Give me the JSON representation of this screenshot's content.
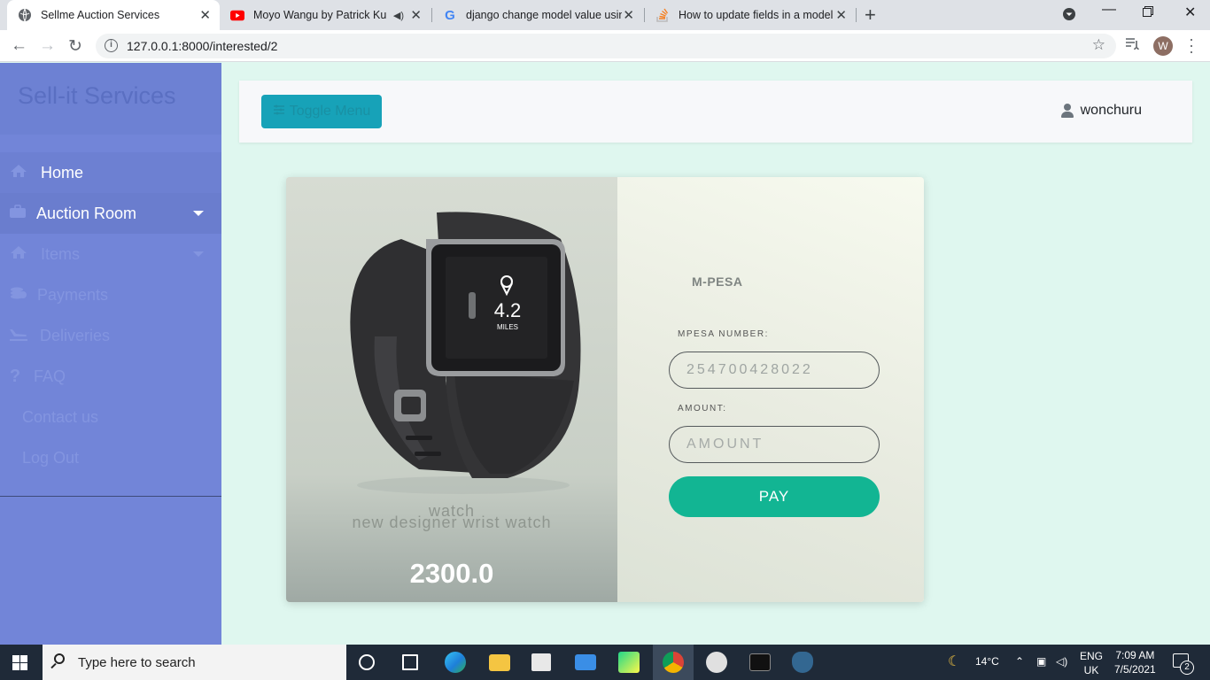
{
  "browser": {
    "tabs": [
      {
        "title": "Sellme Auction Services",
        "icon": "globe-icon",
        "active": true
      },
      {
        "title": "Moyo Wangu by Patrick Kub",
        "icon": "youtube-icon",
        "active": false
      },
      {
        "title": "django change model value usinc",
        "icon": "google-icon",
        "active": false
      },
      {
        "title": "How to update fields in a model",
        "icon": "stackoverflow-icon",
        "active": false
      }
    ],
    "url": "127.0.0.1:8000/interested/2",
    "profile_initial": "W"
  },
  "sidebar": {
    "brand": "Sell-it Services",
    "items": [
      {
        "label": "Home",
        "icon": "home-icon"
      },
      {
        "label": "Auction Room",
        "icon": "briefcase-icon"
      },
      {
        "label": "Items",
        "icon": "home-icon"
      },
      {
        "label": "Payments",
        "icon": "coins-icon"
      },
      {
        "label": "Deliveries",
        "icon": "plane-icon"
      },
      {
        "label": "FAQ",
        "icon": "question-icon"
      },
      {
        "label": "Contact us",
        "icon": ""
      },
      {
        "label": "Log Out",
        "icon": ""
      }
    ]
  },
  "header": {
    "toggle_label": "Toggle Menu",
    "username": "wonchuru"
  },
  "product": {
    "name": "watch",
    "description": "new designer wrist watch",
    "price": "2300.0",
    "screen_value": "4.2",
    "screen_unit": "MILES"
  },
  "payment": {
    "logo": "M-PESA",
    "number_label": "MPESA NUMBER:",
    "number_value": "254700428022",
    "amount_label": "AMOUNT:",
    "amount_placeholder": "AMOUNT",
    "pay_label": "PAY"
  },
  "taskbar": {
    "search_placeholder": "Type here to search",
    "weather": "14°C",
    "language": "ENG",
    "region": "UK",
    "time": "7:09 AM",
    "date": "7/5/2021",
    "notification_count": "2"
  },
  "colors": {
    "sidebar": "#7285d8",
    "toggle": "#17a2b8",
    "pay": "#12b593",
    "background": "#dff7ef"
  }
}
